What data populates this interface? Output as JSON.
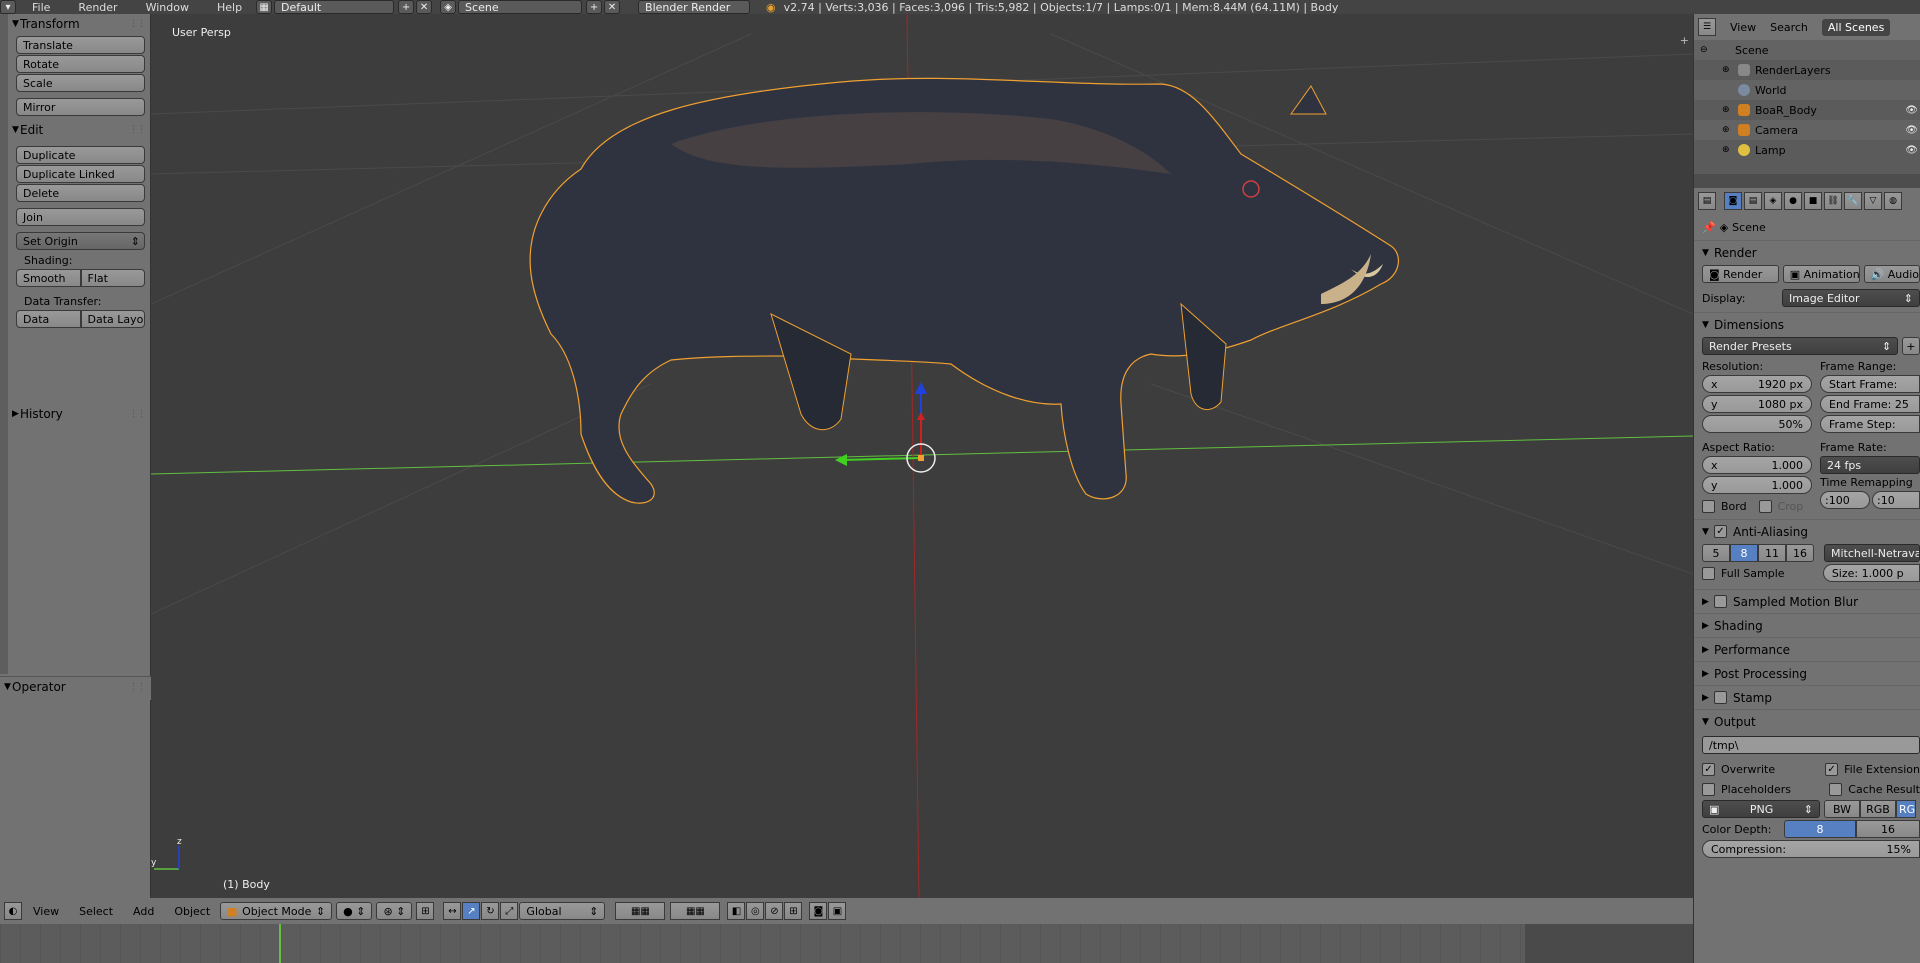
{
  "topbar": {
    "menu": [
      "File",
      "Render",
      "Window",
      "Help"
    ],
    "screen_layout": "Default",
    "scene": "Scene",
    "engine": "Blender Render",
    "stats": "v2.74 | Verts:3,036 | Faces:3,096 | Tris:5,982 | Objects:1/7 | Lamps:0/1 | Mem:8.44M (64.11M) | Body"
  },
  "toolshelf": {
    "transform": {
      "title": "Transform",
      "buttons": [
        "Translate",
        "Rotate",
        "Scale",
        "Mirror"
      ]
    },
    "edit": {
      "title": "Edit",
      "buttons": [
        "Duplicate",
        "Duplicate Linked",
        "Delete",
        "Join"
      ],
      "set_origin": "Set Origin",
      "shading_label": "Shading:",
      "smooth": "Smooth",
      "flat": "Flat",
      "data_transfer_label": "Data Transfer:",
      "data": "Data",
      "data_layout": "Data Layo"
    },
    "history": "History",
    "operator": "Operator"
  },
  "viewport": {
    "view_label": "User Persp",
    "object_label": "(1) Body"
  },
  "vpheader": {
    "menu": [
      "View",
      "Select",
      "Add",
      "Object"
    ],
    "mode": "Object Mode",
    "orientation": "Global"
  },
  "outliner": {
    "header": [
      "View",
      "Search",
      "All Scenes"
    ],
    "rows": [
      "Scene",
      "RenderLayers",
      "World",
      "BoaR_Body",
      "Camera",
      "Lamp"
    ]
  },
  "properties": {
    "context": "Scene",
    "render": {
      "title": "Render",
      "buttons": [
        "Render",
        "Animation",
        "Audio"
      ],
      "display_label": "Display:",
      "display_value": "Image Editor"
    },
    "dimensions": {
      "title": "Dimensions",
      "presets": "Render Presets",
      "resolution_label": "Resolution:",
      "res_x": "1920 px",
      "res_y": "1080 px",
      "res_pct": "50%",
      "frame_range_label": "Frame Range:",
      "start_frame": "Start Frame:",
      "end_frame": "End Frame: 25",
      "frame_step": "Frame Step:",
      "aspect_label": "Aspect Ratio:",
      "aspect_x": "1.000",
      "aspect_y": "1.000",
      "frame_rate_label": "Frame Rate:",
      "frame_rate": "24 fps",
      "time_remap_label": "Time Remapping",
      "time_old": ":100",
      "time_new": ":10",
      "bord": "Bord",
      "crop": "Crop"
    },
    "anti_aliasing": {
      "title": "Anti-Aliasing",
      "samples": [
        "5",
        "8",
        "11",
        "16"
      ],
      "filter": "Mitchell-Netrava",
      "full_sample": "Full Sample",
      "size": "Size:  1.000 p"
    },
    "panels": [
      "Sampled Motion Blur",
      "Shading",
      "Performance",
      "Post Processing",
      "Stamp"
    ],
    "output": {
      "title": "Output",
      "path": "/tmp\\",
      "overwrite": "Overwrite",
      "file_ext": "File Extension",
      "placeholders": "Placeholders",
      "cache": "Cache Result",
      "format": "PNG",
      "color_modes": [
        "BW",
        "RGB",
        "RGBA"
      ],
      "color_depth_label": "Color Depth:",
      "depth_8": "8",
      "depth_16": "16",
      "compression": "Compression:",
      "compression_value": "15%"
    }
  },
  "axis": {
    "x_label": "x",
    "y_label": "y",
    "z_label": "z"
  },
  "colors": {
    "selection_outline": "#f0a030",
    "accent": "#5680c2",
    "x_axis": "#c03030",
    "y_axis": "#60c040",
    "z_axis": "#2040e0"
  }
}
